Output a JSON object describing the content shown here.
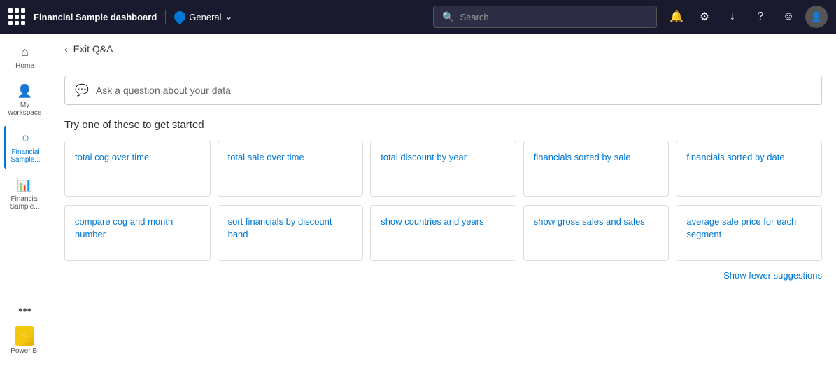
{
  "topnav": {
    "title": "Financial Sample dashboard",
    "badge": "General",
    "search_placeholder": "Search"
  },
  "sidebar": {
    "items": [
      {
        "id": "home",
        "label": "Home",
        "icon": "⌂"
      },
      {
        "id": "my-workspace",
        "label": "My workspace",
        "icon": "👤"
      },
      {
        "id": "financial-sample-1",
        "label": "Financial Sample...",
        "icon": "◎",
        "active": true
      },
      {
        "id": "financial-sample-2",
        "label": "Financial Sample...",
        "icon": "📊"
      }
    ],
    "more_label": "•••",
    "powerbi_label": "Power BI"
  },
  "subheader": {
    "back_label": "Exit Q&A"
  },
  "qna": {
    "input_placeholder": "Ask a question about your data",
    "suggestions_title": "Try one of these to get started",
    "show_fewer_label": "Show fewer suggestions",
    "suggestions_row1": [
      {
        "id": "total-cog-over-time",
        "label": "total cog over time"
      },
      {
        "id": "total-sale-over-time",
        "label": "total sale over time"
      },
      {
        "id": "total-discount-by-year",
        "label": "total discount by year"
      },
      {
        "id": "financials-sorted-by-sale",
        "label": "financials sorted by sale"
      },
      {
        "id": "financials-sorted-by-date",
        "label": "financials sorted by date"
      }
    ],
    "suggestions_row2": [
      {
        "id": "compare-cog-and-month",
        "label": "compare cog and month number"
      },
      {
        "id": "sort-financials-discount",
        "label": "sort financials by discount band"
      },
      {
        "id": "show-countries-and-years",
        "label": "show countries and years"
      },
      {
        "id": "show-gross-sales-and-sales",
        "label": "show gross sales and sales"
      },
      {
        "id": "average-sale-price",
        "label": "average sale price for each segment"
      }
    ]
  }
}
